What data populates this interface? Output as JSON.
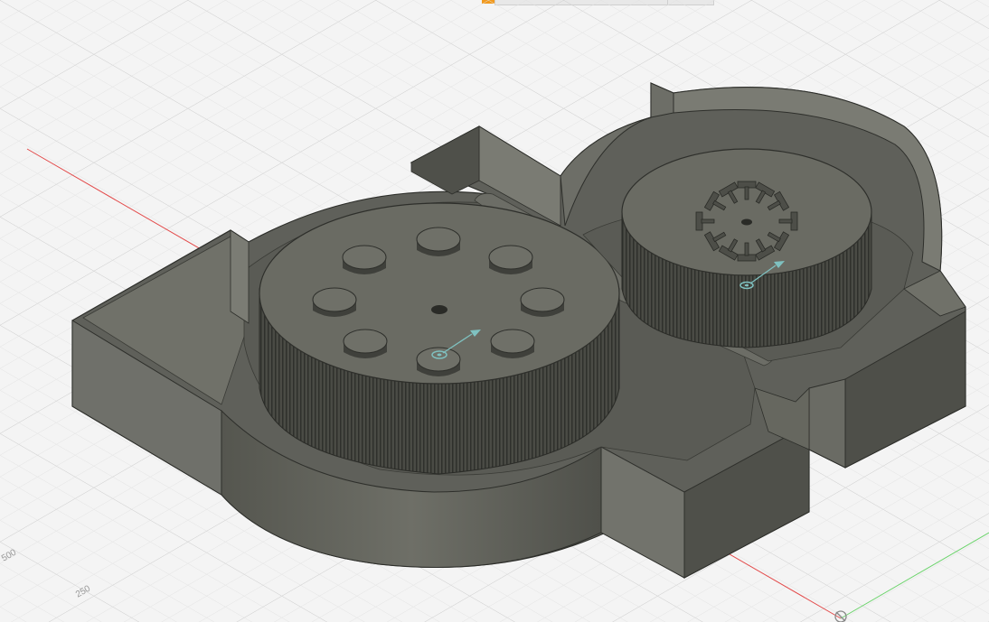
{
  "viewport": {
    "ruler_labels": [
      "250",
      "500"
    ],
    "colors": {
      "background": "#f4f4f4",
      "grid_minor": "#e2e2e2",
      "grid_major": "#d2d2d2",
      "x_axis": "#e34b4b",
      "y_axis": "#6ad36a",
      "model_dark": "#3e3f3a",
      "model_mid": "#5c5d56",
      "model_light": "#76776f",
      "model_top": "#6a6b63",
      "accent_teal": "#7fc1c0"
    },
    "icons": [
      "origin-marker-icon",
      "axis-arrow-icon"
    ]
  }
}
